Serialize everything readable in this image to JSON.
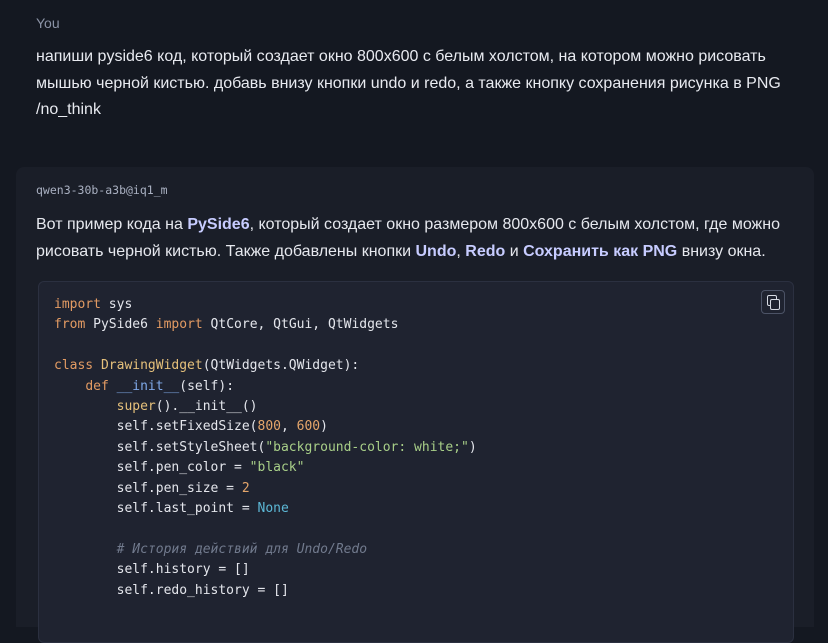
{
  "user_message": {
    "author": "You",
    "text": "напиши pyside6 код, который создает окно 800x600 с белым холстом, на котором можно рисовать мышью черной кистью. добавь внизу кнопки undo и redo, а также кнопку сохранения рисунка в PNG /no_think"
  },
  "assistant_message": {
    "author": "qwen3-30b-a3b@iq1_m",
    "intro": {
      "t1": "Вот пример кода на ",
      "b1": "PySide6",
      "t2": ", который создает окно размером 800x600 с белым холстом, где можно рисовать черной кистью. Также добавлены кнопки ",
      "b2": "Undo",
      "t3": ", ",
      "b3": "Redo",
      "t4": " и ",
      "b4": "Сохранить как PNG",
      "t5": " внизу окна."
    },
    "code": {
      "l1": [
        "import",
        " sys"
      ],
      "l2": [
        "from",
        " PySide6 ",
        "import",
        " QtCore, QtGui, QtWidgets"
      ],
      "l4": [
        "class",
        " ",
        "DrawingWidget",
        "(QtWidgets.QWidget):"
      ],
      "l5": [
        "    ",
        "def",
        " ",
        "__init__",
        "(self):"
      ],
      "l6": [
        "        ",
        "super",
        "().__init__()"
      ],
      "l7": [
        "        self.setFixedSize(",
        "800",
        ", ",
        "600",
        ")"
      ],
      "l8": [
        "        self.setStyleSheet(",
        "\"background-color: white;\"",
        ")"
      ],
      "l9": [
        "        self.pen_color = ",
        "\"black\""
      ],
      "l10": [
        "        self.pen_size = ",
        "2"
      ],
      "l11": [
        "        self.last_point = ",
        "None"
      ],
      "l13": [
        "        ",
        "# История действий для Undo/Redo"
      ],
      "l14": [
        "        self.history = []"
      ],
      "l15": [
        "        self.redo_history = []"
      ]
    }
  }
}
